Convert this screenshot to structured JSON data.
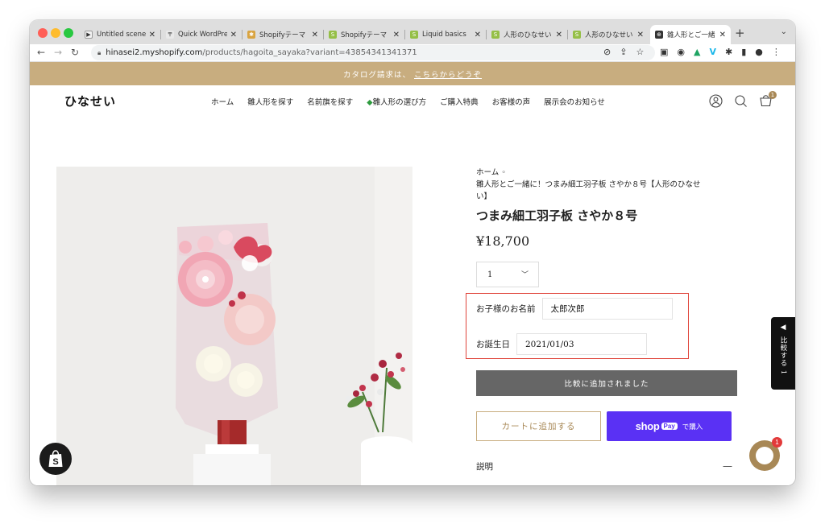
{
  "browser": {
    "tabs": [
      {
        "title": "Untitled scene",
        "favicon_color": "#f2f2f2",
        "favicon_glyph": "▶"
      },
      {
        "title": "Quick WordPre",
        "favicon_color": "#e9e9e9",
        "favicon_glyph": "〒"
      },
      {
        "title": "Shopifyテーマ",
        "favicon_color": "#d9a441",
        "favicon_glyph": "✱"
      },
      {
        "title": "Shopifyテーマ",
        "favicon_color": "#95bf47",
        "favicon_glyph": "S"
      },
      {
        "title": "Liquid basics",
        "favicon_color": "#95bf47",
        "favicon_glyph": "S"
      },
      {
        "title": "人形のひなせい",
        "favicon_color": "#95bf47",
        "favicon_glyph": "S"
      },
      {
        "title": "人形のひなせい",
        "favicon_color": "#95bf47",
        "favicon_glyph": "S"
      },
      {
        "title": "雛人形とご一緒",
        "favicon_color": "#333333",
        "favicon_glyph": "⊕",
        "active": true
      }
    ],
    "url_host": "hinasei2.myshopify.com",
    "url_path": "/products/hagoita_sayaka?variant=43854341341371"
  },
  "site": {
    "announcement_text": "カタログ請求は、",
    "announcement_link": "こちらからどうぞ",
    "logo": "ひなせい",
    "nav": [
      "ホーム",
      "雛人形を探す",
      "名前旗を探す",
      "雛人形の選び方",
      "ご購入特典",
      "お客様の声",
      "展示会のお知らせ"
    ],
    "cart_count": "1"
  },
  "product": {
    "breadcrumb_home": "ホーム",
    "breadcrumb_sep": "◦",
    "breadcrumb_line2": "雛人形とご一緒に！つまみ細工羽子板 さやか８号【人形のひなせ",
    "breadcrumb_line3": "い】",
    "title": "つまみ細工羽子板 さやか８号",
    "price": "¥18,700",
    "quantity": "1",
    "child_name_label": "お子様のお名前",
    "child_name_value": "太郎次郎",
    "birthday_label": "お誕生日",
    "birthday_value": "2021/01/03",
    "compare_button": "比較に追加されました",
    "add_to_cart": "カートに追加する",
    "shop_pay_shop": "shop",
    "shop_pay_pay": "Pay",
    "shop_pay_buy": "で購入",
    "description_label": "説明",
    "description_toggle": "—"
  },
  "floating": {
    "compare_tab_label": "比較する",
    "compare_tab_count": "1",
    "chat_badge": "1"
  },
  "colors": {
    "announce_bg": "#c8ad7f",
    "accent_gold": "#a88856",
    "shop_pay": "#5a31f4",
    "highlight": "#e0443a"
  }
}
